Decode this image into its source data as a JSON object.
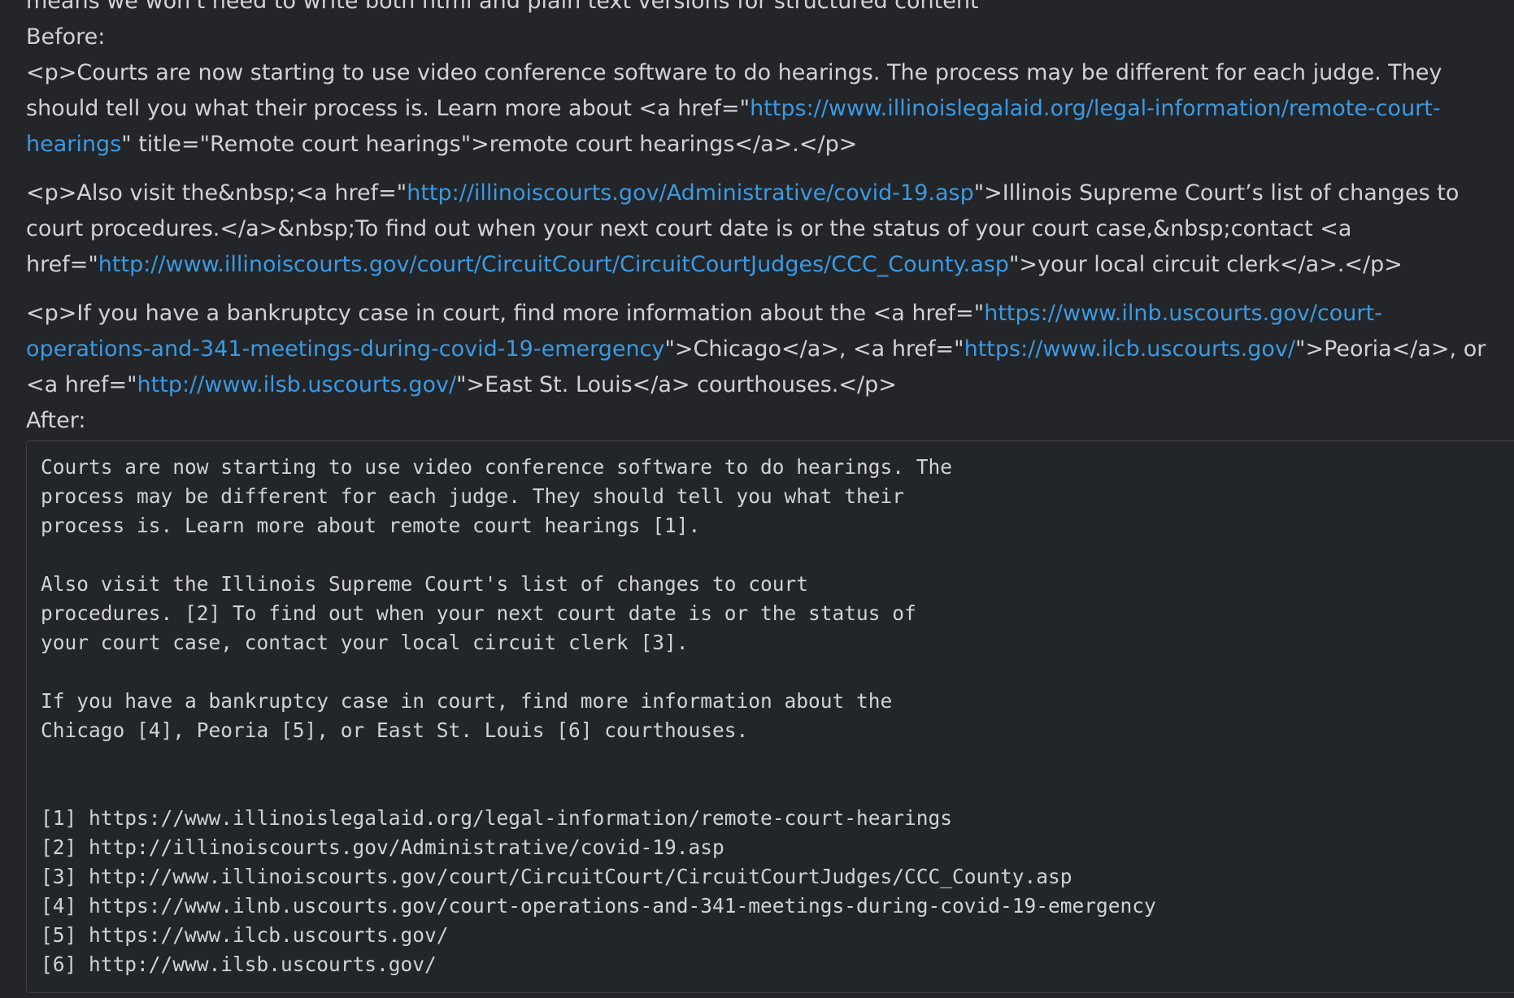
{
  "message": {
    "top_cut_line": "means we won't need to write both html and plain text versions for structured content",
    "before_label": "Before:",
    "before": {
      "p1": {
        "t1": "<p>Courts are now starting to use video conference software to do hearings. The process may be different for each judge. They should tell you what their process is. Learn more about <a href=\"",
        "link": "https://www.illinoislegalaid.org/legal-information/remote-court-hearings",
        "t2": "\" title=\"Remote court hearings\">remote court hearings</a>.</p>"
      },
      "p2": {
        "t1": "<p>Also visit the&nbsp;<a href=\"",
        "link1": "http://illinoiscourts.gov/Administrative/covid-19.asp",
        "t2": "\">Illinois Supreme Court’s list of changes to court procedures.</a>&nbsp;To find out when your next court date is or the status of your court case,&nbsp;contact <a href=\"",
        "link2": "http://www.illinoiscourts.gov/court/CircuitCourt/CircuitCourtJudges/CCC_County.asp",
        "t3": "\">your local circuit clerk</a>.</p>"
      },
      "p3": {
        "t1": "<p>If you have a bankruptcy case in court, find more information about the <a href=\"",
        "link1": "https://www.ilnb.uscourts.gov/court-operations-and-341-meetings-during-covid-19-emergency",
        "t2": "\">Chicago</a>, <a href=\"",
        "link2": "https://www.ilcb.uscourts.gov/",
        "t3": "\">Peoria</a>, or <a href=\"",
        "link3": "http://www.ilsb.uscourts.gov/",
        "t4": "\">East St. Louis</a> courthouses.</p>"
      }
    },
    "after_label": "After:",
    "after_code": {
      "para1": [
        "Courts are now starting to use video conference software to do hearings. The",
        "process may be different for each judge. They should tell you what their",
        "process is. Learn more about remote court hearings [1]."
      ],
      "para2": [
        "Also visit the Illinois Supreme Court's list of changes to court",
        "procedures. [2] To find out when your next court date is or the status of",
        "your court case, contact your local circuit clerk [3]."
      ],
      "para3": [
        "If you have a bankruptcy case in court, find more information about the",
        "Chicago [4], Peoria [5], or East St. Louis [6] courthouses."
      ],
      "refs": [
        "[1] https://www.illinoislegalaid.org/legal-information/remote-court-hearings",
        "[2] http://illinoiscourts.gov/Administrative/covid-19.asp",
        "[3] http://www.illinoiscourts.gov/court/CircuitCourt/CircuitCourtJudges/CCC_County.asp",
        "[4] https://www.ilnb.uscourts.gov/court-operations-and-341-meetings-during-covid-19-emergency",
        "[5] https://www.ilcb.uscourts.gov/",
        "[6] http://www.ilsb.uscourts.gov/"
      ]
    }
  },
  "colors": {
    "background": "#232529",
    "text": "#d1d2d3",
    "link": "#3b9ae1",
    "code_border": "#3d3f43"
  }
}
